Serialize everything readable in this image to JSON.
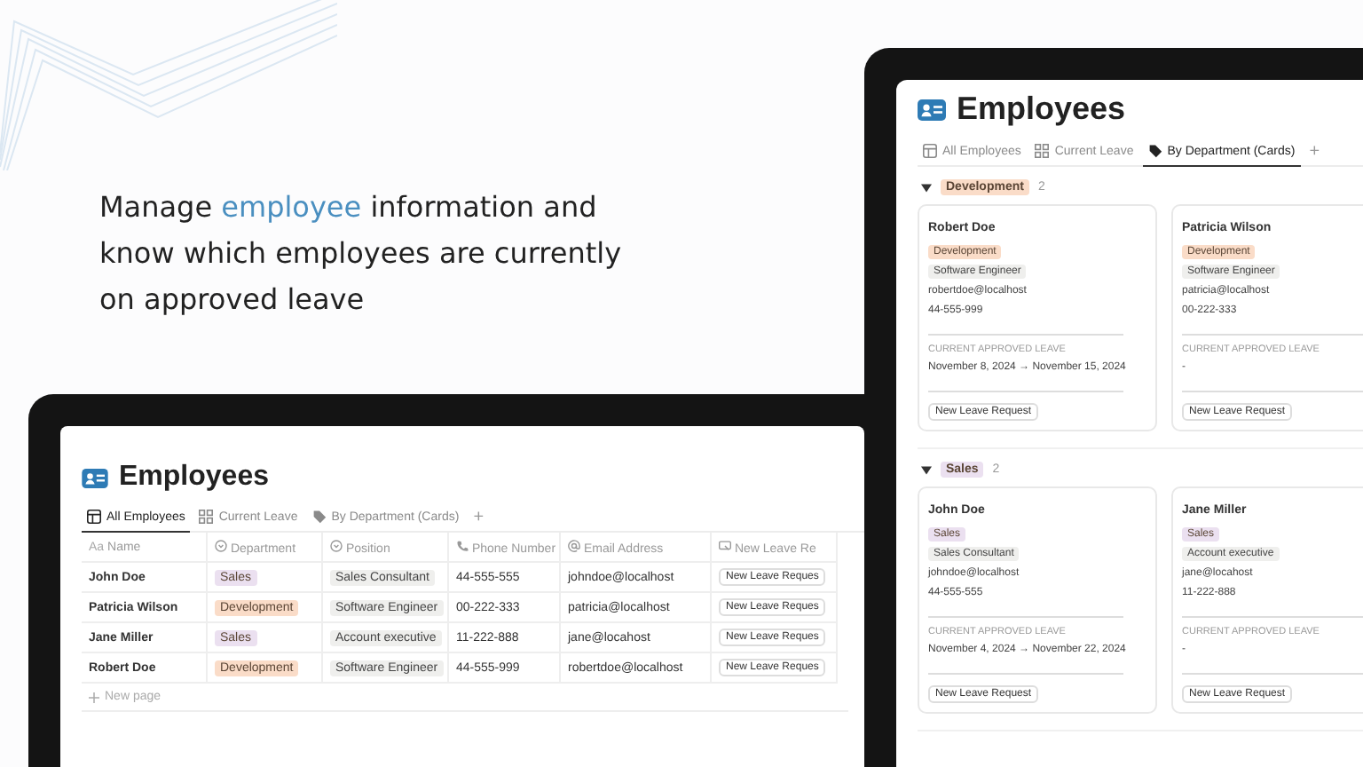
{
  "headline": [
    {
      "text": "Manage ",
      "highlight": false
    },
    {
      "text": "employee",
      "highlight": true
    },
    {
      "text": " information and know which employees are currently on approved leave",
      "highlight": false
    }
  ],
  "table_view": {
    "title": "Employees",
    "tabs": [
      {
        "label": "All Employees",
        "kind": "table",
        "selected": true
      },
      {
        "label": "Current Leave",
        "kind": "board",
        "selected": false
      },
      {
        "label": "By Department (Cards)",
        "kind": "tag",
        "selected": false
      }
    ],
    "add_tab": "+",
    "columns": [
      {
        "label": "Name",
        "kind": "title",
        "prefix": "Aa"
      },
      {
        "label": "Department",
        "kind": "select"
      },
      {
        "label": "Position",
        "kind": "select"
      },
      {
        "label": "Phone Number",
        "kind": "phone"
      },
      {
        "label": "Email Address",
        "kind": "email"
      },
      {
        "label": "New Leave Re",
        "kind": "button"
      }
    ],
    "rows": [
      {
        "name": "John Doe",
        "department": {
          "label": "Sales",
          "color": "#ebe0f0"
        },
        "position": "Sales Consultant",
        "phone": "44-555-555",
        "email": "johndoe@localhost",
        "action": "New Leave Reques"
      },
      {
        "name": "Patricia Wilson",
        "department": {
          "label": "Development",
          "color": "#fadcc8"
        },
        "position": "Software Engineer",
        "phone": "00-222-333",
        "email": "patricia@localhost",
        "action": "New Leave Reques"
      },
      {
        "name": "Jane Miller",
        "department": {
          "label": "Sales",
          "color": "#ebe0f0"
        },
        "position": "Account executive",
        "phone": "11-222-888",
        "email": "jane@locahost",
        "action": "New Leave Reques"
      },
      {
        "name": "Robert Doe",
        "department": {
          "label": "Development",
          "color": "#fadcc8"
        },
        "position": "Software Engineer",
        "phone": "44-555-999",
        "email": "robertdoe@localhost",
        "action": "New Leave Reques"
      }
    ],
    "new_row": "New page"
  },
  "cards_view": {
    "title": "Employees",
    "tabs": [
      {
        "label": "All Employees",
        "kind": "table",
        "selected": false
      },
      {
        "label": "Current Leave",
        "kind": "board",
        "selected": false
      },
      {
        "label": "By Department (Cards)",
        "kind": "tag",
        "selected": true
      }
    ],
    "add_tab": "+",
    "groups": [
      {
        "label": "Development",
        "color": "#fadcc8",
        "count": "2",
        "expanded": true,
        "cards": [
          {
            "name": "Robert Doe",
            "department": {
              "label": "Development",
              "color": "#fadcc8"
            },
            "position": "Software Engineer",
            "email": "robertdoe@localhost",
            "phone": "44-555-999",
            "leave_label": "CURRENT APPROVED LEAVE",
            "leave": "November 8, 2024 → November 15, 2024",
            "action": "New Leave Request"
          },
          {
            "name": "Patricia Wilson",
            "department": {
              "label": "Development",
              "color": "#fadcc8"
            },
            "position": "Software Engineer",
            "email": "patricia@localhost",
            "phone": "00-222-333",
            "leave_label": "CURRENT APPROVED LEAVE",
            "leave": "-",
            "action": "New Leave Request"
          }
        ]
      },
      {
        "label": "Sales",
        "color": "#ebe0f0",
        "count": "2",
        "expanded": true,
        "cards": [
          {
            "name": "John Doe",
            "department": {
              "label": "Sales",
              "color": "#ebe0f0"
            },
            "position": "Sales Consultant",
            "email": "johndoe@localhost",
            "phone": "44-555-555",
            "leave_label": "CURRENT APPROVED LEAVE",
            "leave": "November 4, 2024 → November 22, 2024",
            "action": "New Leave Request"
          },
          {
            "name": "Jane Miller",
            "department": {
              "label": "Sales",
              "color": "#ebe0f0"
            },
            "position": "Account executive",
            "email": "jane@locahost",
            "phone": "11-222-888",
            "leave_label": "CURRENT APPROVED LEAVE",
            "leave": "-",
            "action": "New Leave Request"
          }
        ]
      }
    ]
  }
}
